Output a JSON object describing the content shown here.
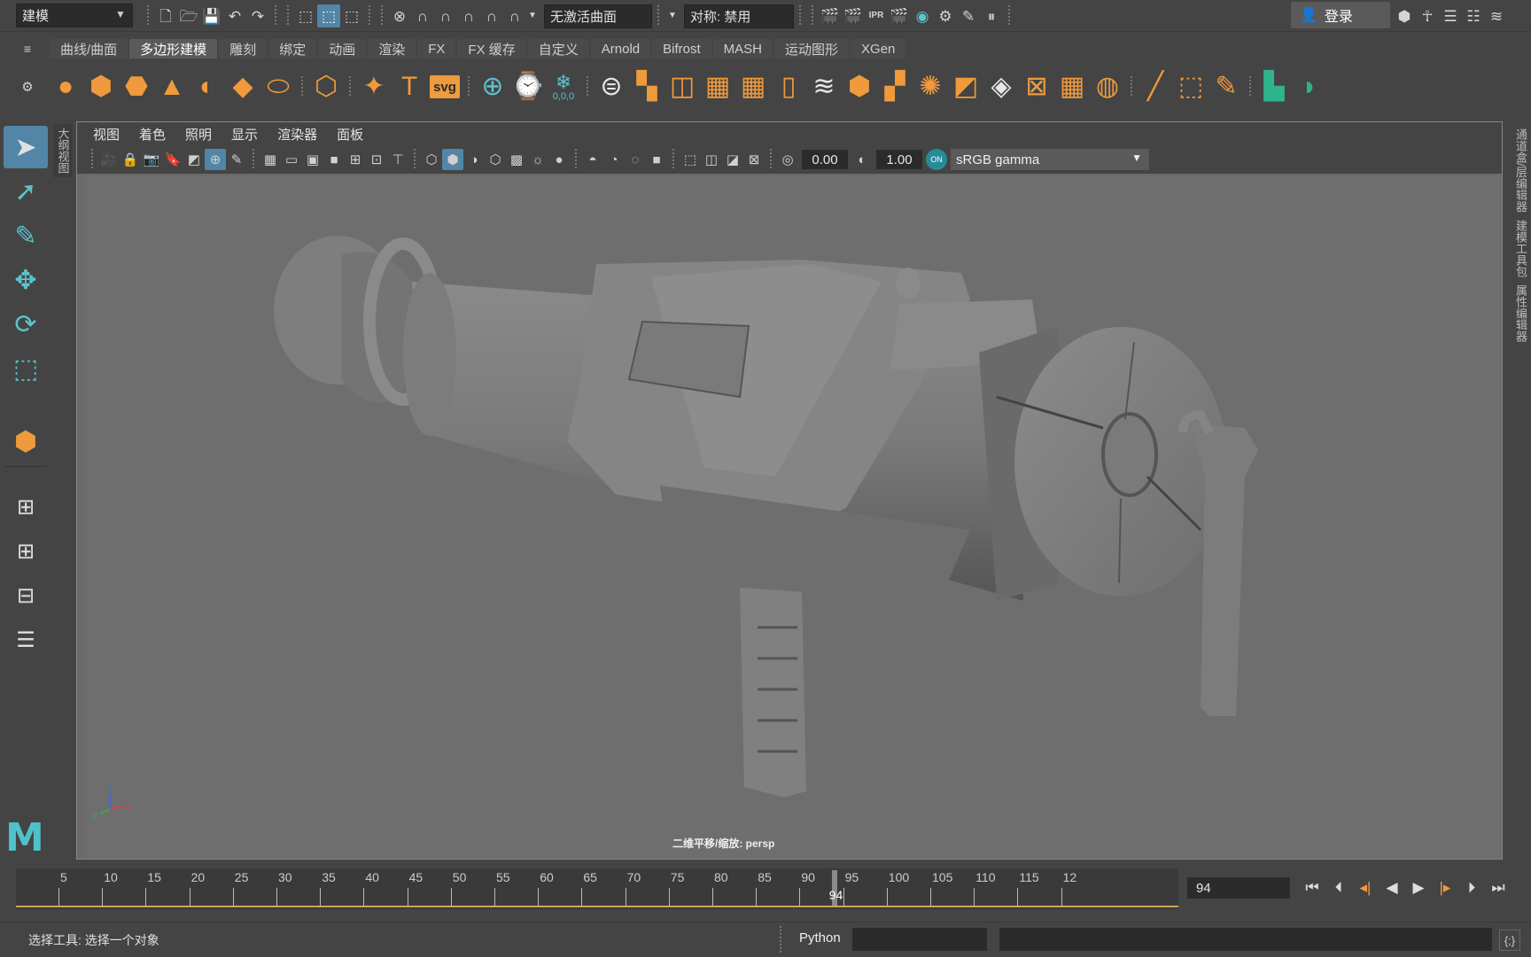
{
  "app": {
    "menu_set": "建模",
    "live_surface": "无激活曲面",
    "symmetry": "对称: 禁用",
    "login": "登录"
  },
  "shelf_tabs": [
    "曲线/曲面",
    "多边形建模",
    "雕刻",
    "绑定",
    "动画",
    "渲染",
    "FX",
    "FX 缓存",
    "自定义",
    "Arnold",
    "Bifrost",
    "MASH",
    "运动图形",
    "XGen"
  ],
  "active_shelf_tab": "多边形建模",
  "shelf": {
    "svg_label": "svg",
    "text_label": "T",
    "coord_label": "0,0,0"
  },
  "outliner_tab": "大纲视图",
  "viewport": {
    "menus": [
      "视图",
      "着色",
      "照明",
      "显示",
      "渲染器",
      "面板"
    ],
    "exposure": "0.00",
    "gamma": "1.00",
    "color_space": "sRGB gamma",
    "camera_label": "二维平移/缩放: persp"
  },
  "right_tabs": [
    "通道盒/层编辑器",
    "建模工具包",
    "属性编辑器"
  ],
  "timeline": {
    "ticks": [
      "5",
      "10",
      "15",
      "20",
      "25",
      "30",
      "35",
      "40",
      "45",
      "50",
      "55",
      "60",
      "65",
      "70",
      "75",
      "80",
      "85",
      "90",
      "95",
      "100",
      "105",
      "110",
      "115",
      "12"
    ],
    "current_frame": "94",
    "current_frame_field": "94"
  },
  "status": {
    "help_line": "选择工具: 选择一个对象",
    "script_lang": "Python"
  },
  "colors": {
    "accent_blue": "#5285a6",
    "shelf_orange": "#ef9a3c",
    "maya_teal": "#4fc1c9",
    "timeline_gold": "#c9a75a"
  }
}
